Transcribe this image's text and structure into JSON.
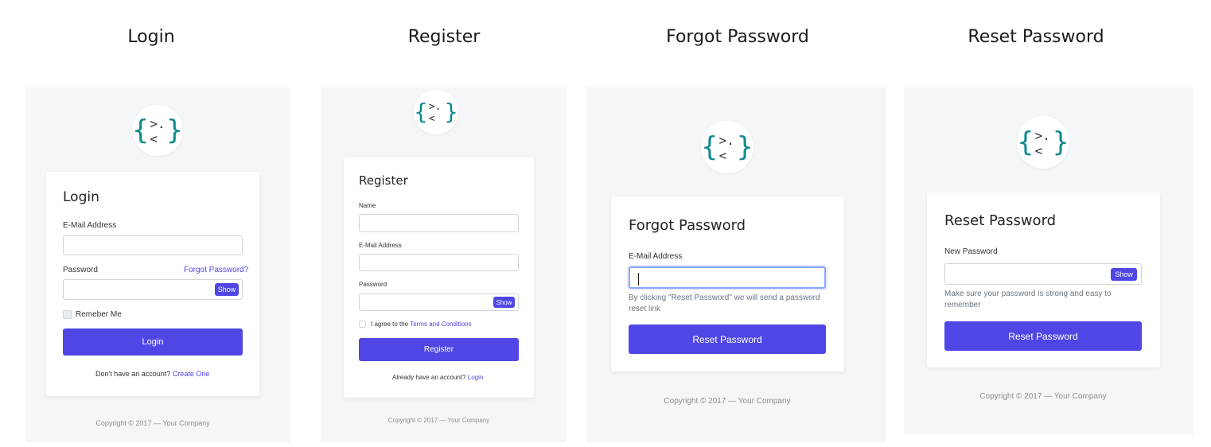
{
  "headings": [
    "Login",
    "Register",
    "Forgot Password",
    "Reset Password"
  ],
  "brand": {
    "logo_left": "{",
    "logo_face": ">.<",
    "logo_right": "}",
    "accent": "#4f46e5",
    "logo_color": "#0f8a8f"
  },
  "login": {
    "title": "Login",
    "email_label": "E-Mail Address",
    "password_label": "Password",
    "forgot_link": "Forgot Password?",
    "show_label": "Show",
    "remember_label": "Remeber Me",
    "submit": "Login",
    "no_account": "Don't have an account?",
    "create_link": "Create One",
    "footer": "Copyright © 2017 — Your Company"
  },
  "register": {
    "title": "Register",
    "name_label": "Name",
    "email_label": "E-Mail Address",
    "password_label": "Password",
    "show_label": "Show",
    "agree_text": "I agree to the",
    "terms_link": "Terms and Conditions",
    "submit": "Register",
    "have_account": "Already have an account?",
    "login_link": "Login",
    "footer": "Copyright © 2017 — Your Company"
  },
  "forgot": {
    "title": "Forgot Password",
    "email_label": "E-Mail Address",
    "help_line1": "By clicking \"Reset Password\" we will send a password",
    "help_line2": "reset link",
    "submit": "Reset Password",
    "footer": "Copyright © 2017 — Your Company"
  },
  "reset": {
    "title": "Reset Password",
    "password_label": "New Password",
    "show_label": "Show",
    "help_line1": "Make sure your password is strong and easy to",
    "help_line2": "remember",
    "submit": "Reset Password",
    "footer": "Copyright © 2017 — Your Company"
  }
}
